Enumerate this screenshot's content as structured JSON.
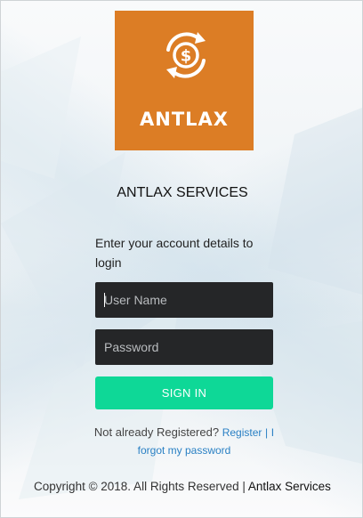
{
  "logo": {
    "text": "ANTLAX",
    "background": "#dc7d25",
    "icon": "dollar-cycle-icon"
  },
  "app_title": "ANTLAX SERVICES",
  "instructions": "Enter your account details to login",
  "form": {
    "username_placeholder": "User Name",
    "username_value": "",
    "password_placeholder": "Password",
    "password_value": "",
    "signin_label": "SIGN IN",
    "field_background": "#252628",
    "button_color": "#0ed897"
  },
  "registration": {
    "prompt": "Not already Registered?",
    "register_link": "Register",
    "separator": "|",
    "forgot_link": "I forgot my password",
    "link_color": "#2a80c4"
  },
  "footer": {
    "copyright": "Copyright © 2018. All Rights Reserved |",
    "brand": "Antlax Services"
  }
}
